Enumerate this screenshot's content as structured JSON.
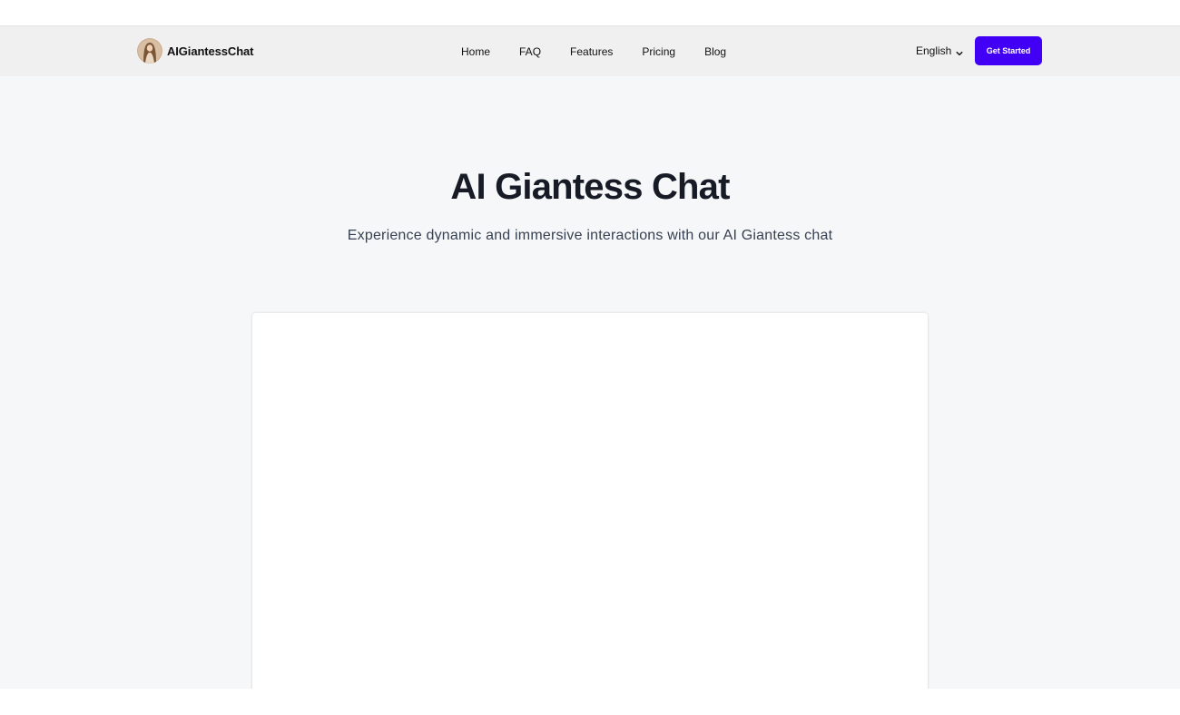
{
  "header": {
    "brand_name": "AIGiantessChat",
    "logo_icon": "woman-portrait-avatar",
    "nav": [
      {
        "label": "Home"
      },
      {
        "label": "FAQ"
      },
      {
        "label": "Features"
      },
      {
        "label": "Pricing"
      },
      {
        "label": "Blog"
      }
    ],
    "language": {
      "selected": "English",
      "icon": "chevron-down-icon"
    },
    "cta_label": "Get Started"
  },
  "hero": {
    "title": "AI Giantess Chat",
    "subtitle": "Experience dynamic and immersive interactions with our AI Giantess chat"
  },
  "colors": {
    "accent": "#4100f5",
    "navbar_bg": "#f0f0f1",
    "page_bg": "#f6f7f9",
    "title_text": "#171b26"
  }
}
